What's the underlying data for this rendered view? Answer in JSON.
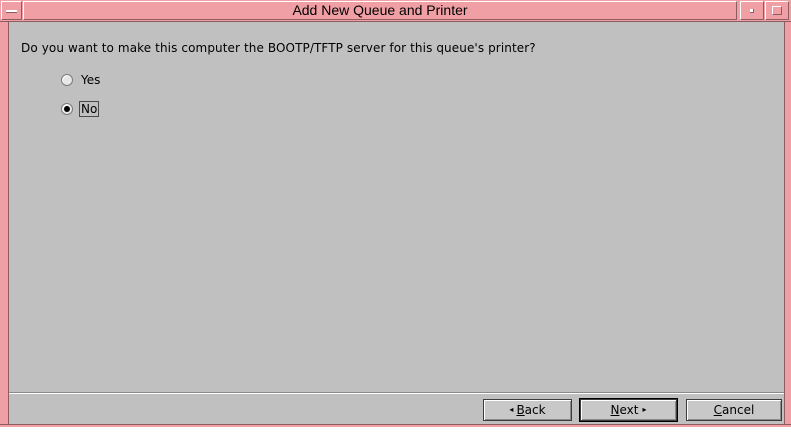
{
  "window": {
    "title": "Add New Queue and Printer"
  },
  "content": {
    "question": "Do you want to make this computer the BOOTP/TFTP server for this queue's printer?",
    "options": [
      {
        "label": "Yes",
        "selected": false
      },
      {
        "label": "No",
        "selected": true
      }
    ]
  },
  "buttons": {
    "back": {
      "mnemonic": "B",
      "rest": "ack",
      "arrow": "◂"
    },
    "next": {
      "mnemonic": "N",
      "rest": "ext",
      "arrow": "▸"
    },
    "cancel": {
      "mnemonic": "C",
      "rest": "ancel"
    }
  },
  "colors": {
    "frame": "#f0a0a4",
    "client_background": "#c0c0c0"
  },
  "icons": {
    "window_menu": "window-menu-icon",
    "minimize": "minimize-icon",
    "maximize": "maximize-icon"
  }
}
